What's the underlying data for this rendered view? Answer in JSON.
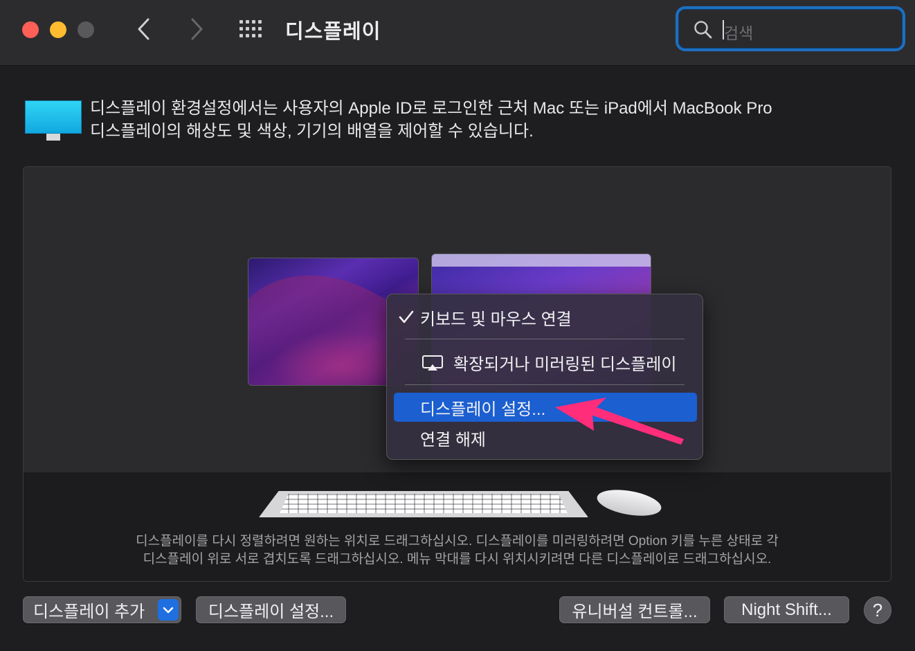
{
  "window": {
    "title": "디스플레이",
    "search_placeholder": "검색"
  },
  "toolbar": {
    "back_icon": "chevron-left-icon",
    "forward_icon": "chevron-right-icon",
    "grid_icon": "grid-icon"
  },
  "header": {
    "line1": "디스플레이 환경설정에서는 사용자의 Apple ID로 로그인한 근처 Mac 또는 iPad에서 MacBook Pro",
    "line2": "디스플레이의 해상도 및 색상, 기기의 배열을 제어할 수 있습니다."
  },
  "arrangement": {
    "help_line1": "디스플레이를 다시 정렬하려면 원하는 위치로 드래그하십시오. 디스플레이를 미러링하려면 Option 키를 누른 상태로 각",
    "help_line2": "디스플레이 위로 서로 겹치도록 드래그하십시오. 메뉴 막대를 다시 위치시키려면 다른 디스플레이로 드래그하십시오."
  },
  "context_menu": {
    "items": [
      {
        "label": "키보드 및 마우스 연결",
        "checked": true
      },
      {
        "label": "확장되거나 미러링된 디스플레이",
        "icon": "airplay-icon"
      },
      {
        "label": "디스플레이 설정...",
        "highlighted": true
      },
      {
        "label": "연결 해제"
      }
    ]
  },
  "buttons": {
    "add_display": "디스플레이 추가",
    "display_settings": "디스플레이 설정...",
    "universal_control": "유니버설 컨트롤...",
    "night_shift": "Night Shift...",
    "help": "?"
  },
  "colors": {
    "accent": "#1f6fe0",
    "highlight": "#1b5fd0",
    "annotation_arrow": "#ff2d7a"
  }
}
